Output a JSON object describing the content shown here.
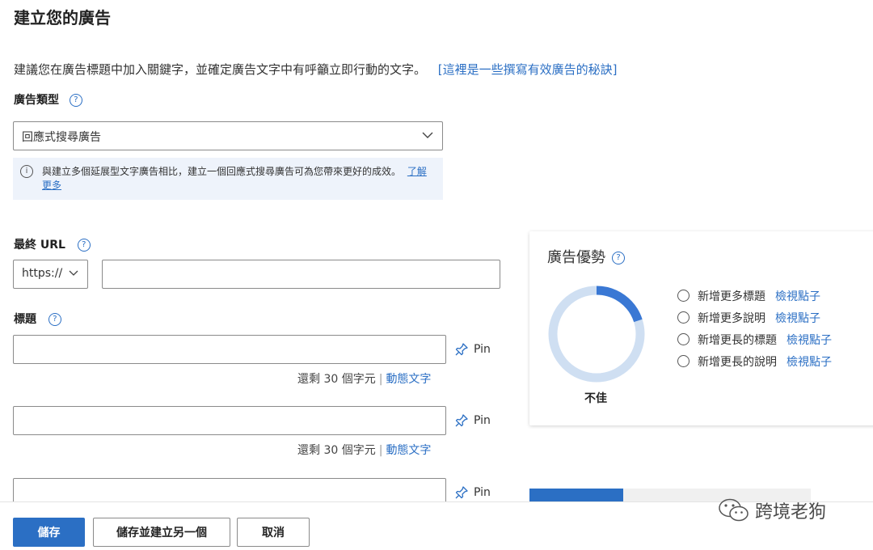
{
  "page": {
    "title": "建立您的廣告",
    "intro_text": "建議您在廣告標題中加入關鍵字，並確定廣告文字中有呼籲立即行動的文字。",
    "intro_link": "[這裡是一些撰寫有效廣告的秘訣]"
  },
  "ad_type": {
    "label": "廣告類型",
    "help_icon": "question-circle-icon",
    "selected": "回應式搜尋廣告",
    "notice_text": "與建立多個延展型文字廣告相比，建立一個回應式搜尋廣告可為您帶來更好的成效。",
    "notice_link": "了解更多"
  },
  "final_url": {
    "label": "最終 URL",
    "protocol": "https://",
    "value": ""
  },
  "headlines": {
    "label": "標題",
    "pin_label": "Pin",
    "items": [
      {
        "value": "",
        "remaining": "還剩 30 個字元",
        "dynamic_text": "動態文字"
      },
      {
        "value": "",
        "remaining": "還剩 30 個字元",
        "dynamic_text": "動態文字"
      },
      {
        "value": ""
      }
    ]
  },
  "ad_strength": {
    "title": "廣告優勢",
    "rating": "不佳",
    "progress": 0.2,
    "colors": {
      "filled": "#3a78d4",
      "track": "#cfdff2"
    },
    "tips": [
      {
        "label": "新增更多標題",
        "link": "檢視點子"
      },
      {
        "label": "新增更多說明",
        "link": "檢視點子"
      },
      {
        "label": "新增更長的標題",
        "link": "檢視點子"
      },
      {
        "label": "新增更長的說明",
        "link": "檢視點子"
      }
    ]
  },
  "footer": {
    "save": "儲存",
    "save_and_new": "儲存並建立另一個",
    "cancel": "取消"
  },
  "watermark": {
    "text": "跨境老狗",
    "icon": "wechat-icon"
  },
  "colors": {
    "accent": "#2b6fc4",
    "notice_bg": "#eef3fb"
  }
}
